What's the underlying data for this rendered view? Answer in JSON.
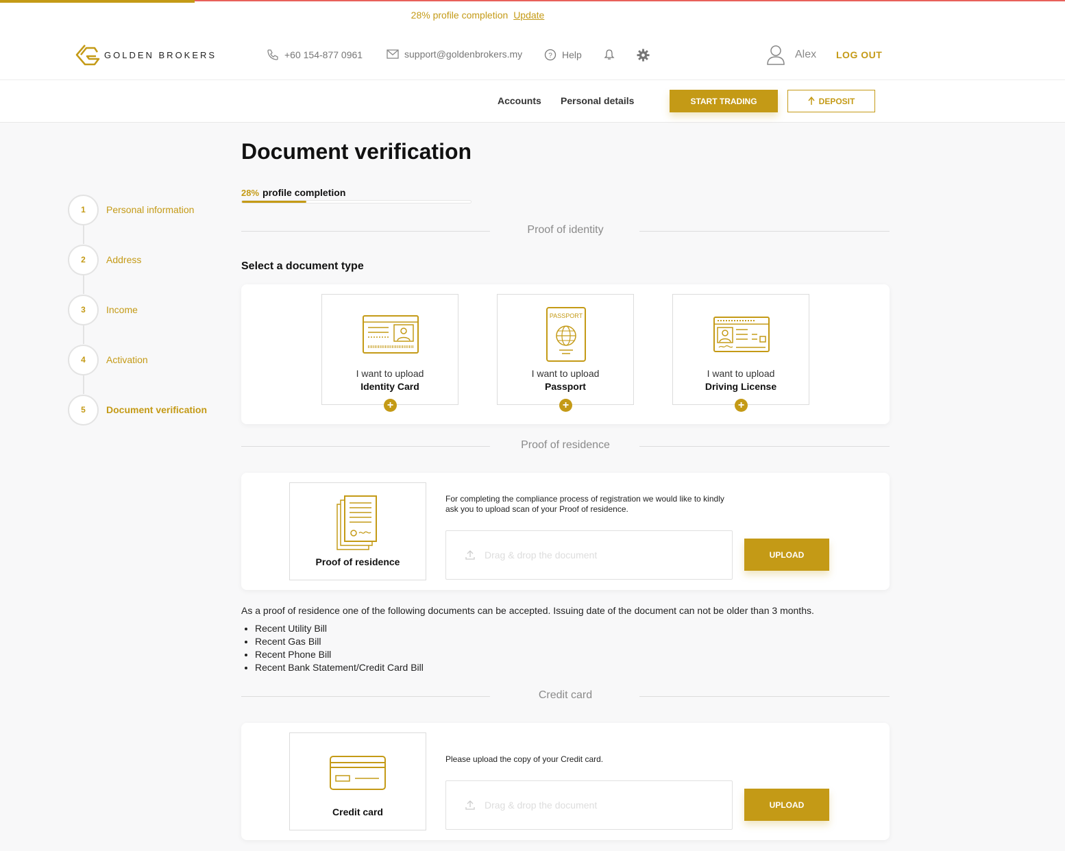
{
  "banner": {
    "text": "28% profile completion",
    "link": "Update"
  },
  "brand": {
    "name": "GOLDEN BROKERS",
    "accent": "#c49a16"
  },
  "header": {
    "phone": "+60 154-877 0961",
    "email": "support@goldenbrokers.my",
    "help": "Help",
    "user": "Alex",
    "logout": "LOG OUT"
  },
  "subnav": {
    "accounts": "Accounts",
    "personal": "Personal details",
    "start_trading": "START TRADING",
    "deposit": "DEPOSIT"
  },
  "steps": [
    {
      "num": "1",
      "label": "Personal information"
    },
    {
      "num": "2",
      "label": "Address"
    },
    {
      "num": "3",
      "label": "Income"
    },
    {
      "num": "4",
      "label": "Activation"
    },
    {
      "num": "5",
      "label": "Document verification"
    }
  ],
  "page": {
    "title": "Document verification",
    "completion_pct": "28%",
    "completion_label": "profile completion",
    "completion_value": 0.28
  },
  "identity": {
    "section": "Proof of identity",
    "select": "Select a document type",
    "tiles": [
      {
        "line1": "I want to upload",
        "line2": "Identity Card",
        "icon": "id-card-icon"
      },
      {
        "line1": "I want to upload",
        "line2": "Passport",
        "icon": "passport-icon",
        "icon_text": "PASSPORT"
      },
      {
        "line1": "I want to upload",
        "line2": "Driving License",
        "icon": "driving-license-icon"
      }
    ]
  },
  "residence": {
    "section": "Proof of residence",
    "tile": "Proof of residence",
    "desc": "For completing the compliance process of registration we would like to kindly ask you to upload scan of your Proof of residence.",
    "drop": "Drag & drop the document",
    "upload": "UPLOAD",
    "note": "As a proof of residence one of the following documents can be accepted. Issuing date of the document can not be older than 3 months.",
    "list": [
      "Recent Utility Bill",
      "Recent Gas Bill",
      "Recent Phone Bill",
      "Recent Bank Statement/Credit Card Bill"
    ]
  },
  "credit": {
    "section": "Credit card",
    "tile": "Credit card",
    "desc": "Please upload the copy of your Credit card.",
    "drop": "Drag & drop the document",
    "upload": "UPLOAD"
  }
}
